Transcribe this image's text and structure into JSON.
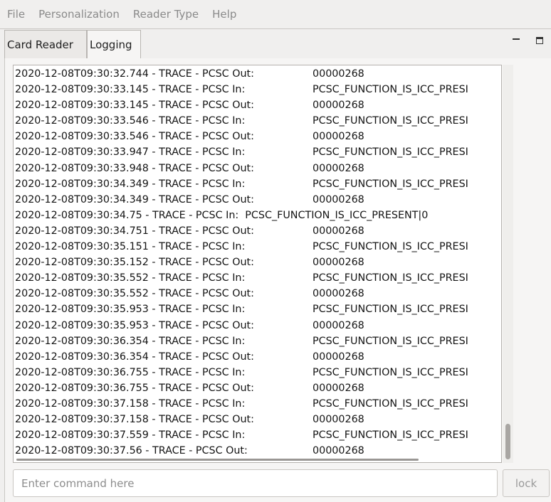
{
  "menu": [
    "File",
    "Personalization",
    "Reader Type",
    "Help"
  ],
  "tabs": [
    {
      "label": "Card Reader",
      "active": false
    },
    {
      "label": "Logging",
      "active": true
    }
  ],
  "window_controls": {
    "minimize_icon": "minimize-icon",
    "maximize_icon": "maximize-icon"
  },
  "log_lines": [
    {
      "prefix": "2020-12-08T09:30:32.744 - TRACE - PCSC Out:",
      "payload": "00000268"
    },
    {
      "prefix": "2020-12-08T09:30:33.145 - TRACE - PCSC In:",
      "payload": "PCSC_FUNCTION_IS_ICC_PRESI"
    },
    {
      "prefix": "2020-12-08T09:30:33.145 - TRACE - PCSC Out:",
      "payload": "00000268"
    },
    {
      "prefix": "2020-12-08T09:30:33.546 - TRACE - PCSC In:",
      "payload": "PCSC_FUNCTION_IS_ICC_PRESI"
    },
    {
      "prefix": "2020-12-08T09:30:33.546 - TRACE - PCSC Out:",
      "payload": "00000268"
    },
    {
      "prefix": "2020-12-08T09:30:33.947 - TRACE - PCSC In:",
      "payload": "PCSC_FUNCTION_IS_ICC_PRESI"
    },
    {
      "prefix": "2020-12-08T09:30:33.948 - TRACE - PCSC Out:",
      "payload": "00000268"
    },
    {
      "prefix": "2020-12-08T09:30:34.349 - TRACE - PCSC In:",
      "payload": "PCSC_FUNCTION_IS_ICC_PRESI"
    },
    {
      "prefix": "2020-12-08T09:30:34.349 - TRACE - PCSC Out:",
      "payload": "00000268"
    },
    {
      "prefix": "",
      "payload": "2020-12-08T09:30:34.75 - TRACE - PCSC In:  PCSC_FUNCTION_IS_ICC_PRESENT|0"
    },
    {
      "prefix": "2020-12-08T09:30:34.751 - TRACE - PCSC Out:",
      "payload": "00000268"
    },
    {
      "prefix": "2020-12-08T09:30:35.151 - TRACE - PCSC In:",
      "payload": "PCSC_FUNCTION_IS_ICC_PRESI"
    },
    {
      "prefix": "2020-12-08T09:30:35.152 - TRACE - PCSC Out:",
      "payload": "00000268"
    },
    {
      "prefix": "2020-12-08T09:30:35.552 - TRACE - PCSC In:",
      "payload": "PCSC_FUNCTION_IS_ICC_PRESI"
    },
    {
      "prefix": "2020-12-08T09:30:35.552 - TRACE - PCSC Out:",
      "payload": "00000268"
    },
    {
      "prefix": "2020-12-08T09:30:35.953 - TRACE - PCSC In:",
      "payload": "PCSC_FUNCTION_IS_ICC_PRESI"
    },
    {
      "prefix": "2020-12-08T09:30:35.953 - TRACE - PCSC Out:",
      "payload": "00000268"
    },
    {
      "prefix": "2020-12-08T09:30:36.354 - TRACE - PCSC In:",
      "payload": "PCSC_FUNCTION_IS_ICC_PRESI"
    },
    {
      "prefix": "2020-12-08T09:30:36.354 - TRACE - PCSC Out:",
      "payload": "00000268"
    },
    {
      "prefix": "2020-12-08T09:30:36.755 - TRACE - PCSC In:",
      "payload": "PCSC_FUNCTION_IS_ICC_PRESI"
    },
    {
      "prefix": "2020-12-08T09:30:36.755 - TRACE - PCSC Out:",
      "payload": "00000268"
    },
    {
      "prefix": "2020-12-08T09:30:37.158 - TRACE - PCSC In:",
      "payload": "PCSC_FUNCTION_IS_ICC_PRESI"
    },
    {
      "prefix": "2020-12-08T09:30:37.158 - TRACE - PCSC Out:",
      "payload": "00000268"
    },
    {
      "prefix": "2020-12-08T09:30:37.559 - TRACE - PCSC In:",
      "payload": "PCSC_FUNCTION_IS_ICC_PRESI"
    },
    {
      "prefix": "2020-12-08T09:30:37.56 - TRACE - PCSC Out:",
      "payload": "00000268"
    }
  ],
  "command": {
    "placeholder": "Enter command here",
    "value": ""
  },
  "lock_button": {
    "label": "lock"
  },
  "colors": {
    "menu_text": "#8a8a8a",
    "panel_bg": "#f6f5f4",
    "log_bg": "#ffffff"
  }
}
